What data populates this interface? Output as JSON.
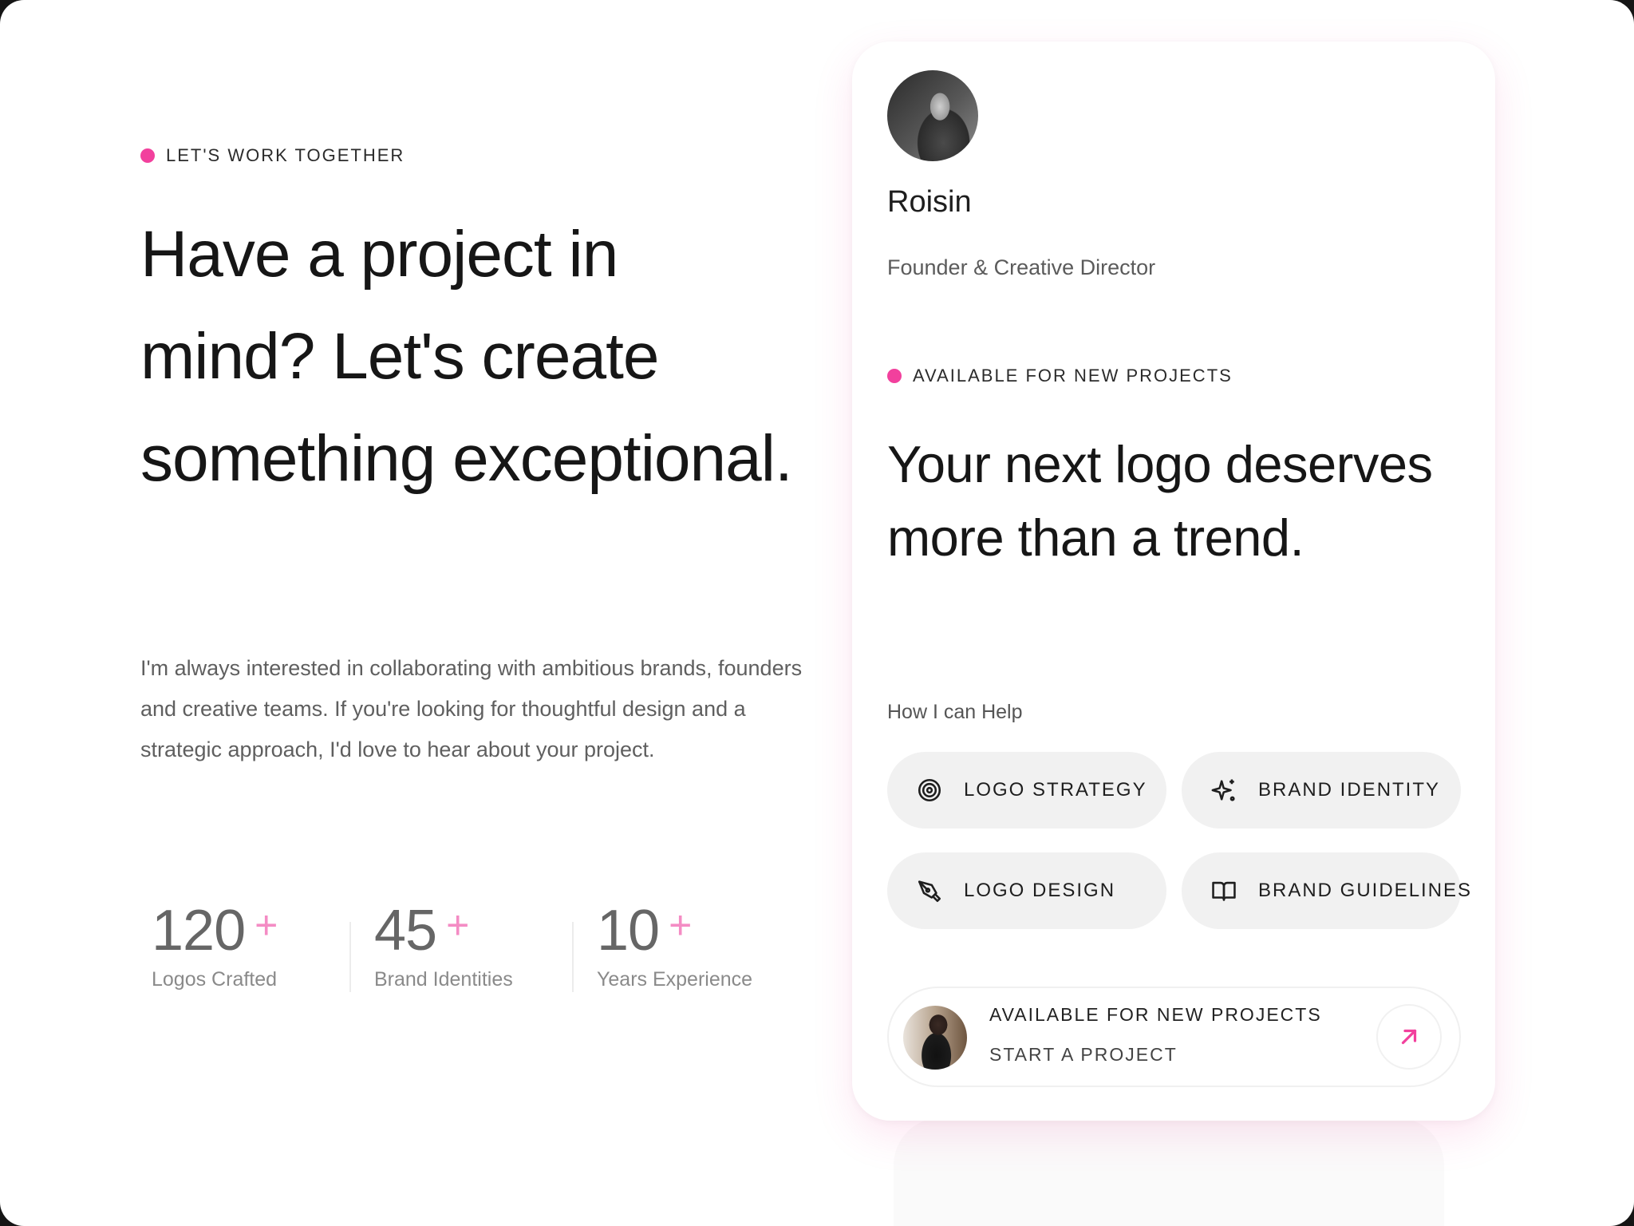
{
  "colors": {
    "accent": "#f2409d",
    "plus": "#f48cc4"
  },
  "contact": {
    "eyebrow": "LET'S WORK TOGETHER",
    "headline": "Have a project in mind? Let's create something exceptional.",
    "description": "I'm always interested in collaborating with ambitious brands, founders and creative teams. If you're looking for thoughtful design and a strategic approach, I'd love to hear about your project."
  },
  "stats": [
    {
      "value": "120",
      "suffix": "+",
      "label": "Logos Crafted"
    },
    {
      "value": "45",
      "suffix": "+",
      "label": "Brand Identities"
    },
    {
      "value": "10",
      "suffix": "+",
      "label": "Years Experience"
    }
  ],
  "profile": {
    "name": "Roisin",
    "role": "Founder & Creative Director",
    "availability": "AVAILABLE FOR NEW PROJECTS",
    "headline": "Your next logo deserves more than a trend.",
    "help_label": "How I can Help"
  },
  "services": [
    {
      "label": "LOGO STRATEGY",
      "icon": "target-icon"
    },
    {
      "label": "BRAND IDENTITY",
      "icon": "sparkle-icon"
    },
    {
      "label": "LOGO DESIGN",
      "icon": "pen-tool-icon"
    },
    {
      "label": "BRAND GUIDELINES",
      "icon": "book-icon"
    }
  ],
  "cta": {
    "title": "AVAILABLE FOR NEW PROJECTS",
    "subtitle": "START A PROJECT",
    "icon": "arrow-up-right-icon"
  }
}
